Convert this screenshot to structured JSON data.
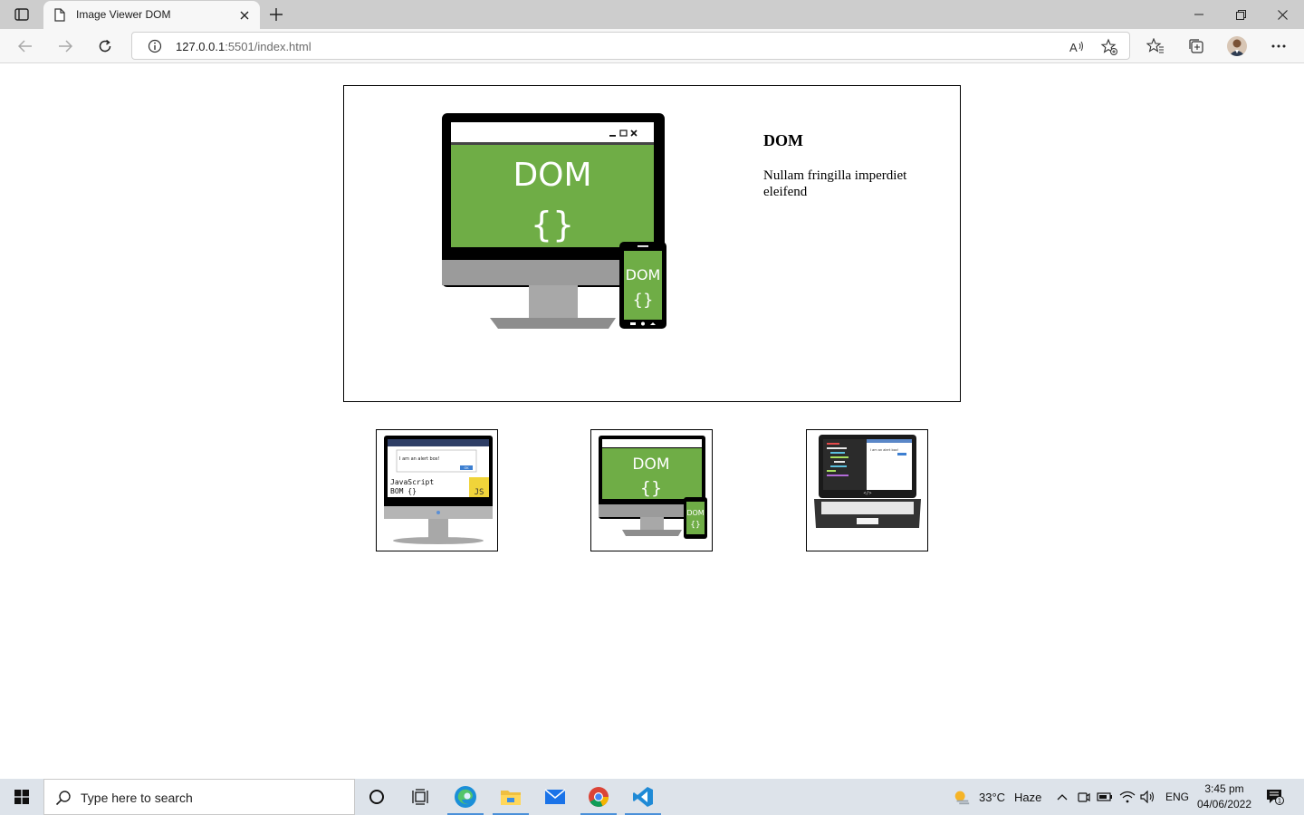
{
  "browser": {
    "tab_title": "Image Viewer DOM",
    "url_host": "127.0.0.1",
    "url_rest": ":5501/index.html"
  },
  "viewer": {
    "title": "DOM",
    "description": "Nullam fringilla imperdiet eleifend",
    "main_image": {
      "screen_text": "DOM",
      "braces_text": "{}",
      "phone_text": "DOM",
      "phone_braces": "{}",
      "screen_color": "#6fad46"
    }
  },
  "thumbnails": [
    {
      "alert_text": "I am an alert box!",
      "ok_label": "OK",
      "code_line1": "JavaScript",
      "code_line2": "BOM {}",
      "badge": "JS"
    },
    {
      "screen_text": "DOM",
      "braces_text": "{}",
      "phone_text": "DOM",
      "phone_braces": "{}"
    },
    {
      "alert_text": "I am an alert box!",
      "tag_text": "</>"
    }
  ],
  "taskbar": {
    "search_placeholder": "Type here to search",
    "weather_temp": "33°C",
    "weather_desc": "Haze",
    "language": "ENG",
    "time": "3:45 pm",
    "date": "04/06/2022",
    "notification_count": "1"
  }
}
